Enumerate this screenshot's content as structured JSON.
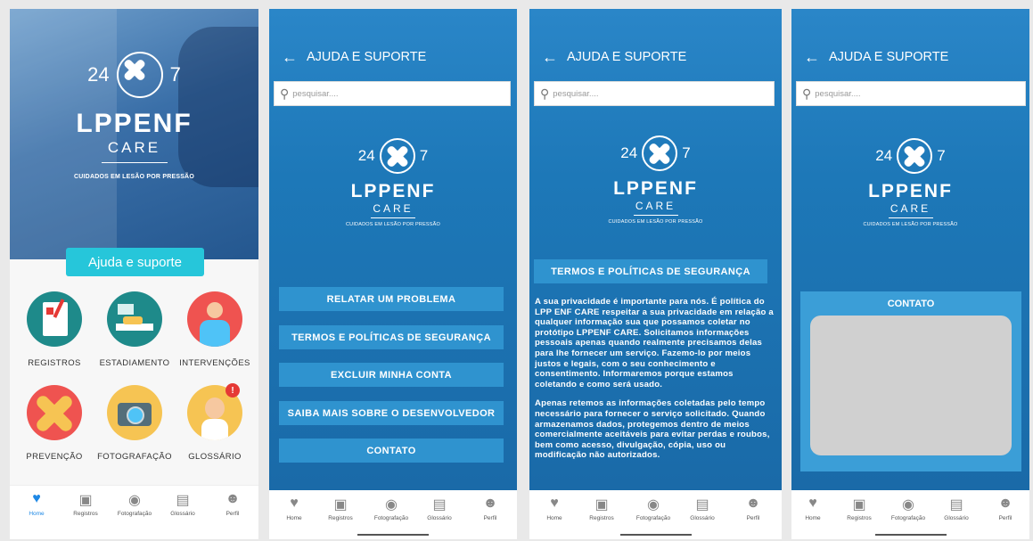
{
  "colors": {
    "accent": "#26c6da",
    "blue": "#1d78b8",
    "badge": "#e53935"
  },
  "logo": {
    "left_num": "24",
    "right_num": "7",
    "name": "LPPENF",
    "care": "CARE",
    "tagline": "CUIDADOS EM LESÃO POR PRESSÃO"
  },
  "screen1": {
    "help_button": "Ajuda e suporte",
    "tiles": [
      {
        "label": "REGISTROS",
        "icon": "clipboard-icon"
      },
      {
        "label": "ESTADIAMENTO",
        "icon": "hospital-bed-icon"
      },
      {
        "label": "INTERVENÇÕES",
        "icon": "injured-patient-icon"
      },
      {
        "label": "PREVENÇÃO",
        "icon": "bandage-icon"
      },
      {
        "label": "FOTOGRAFAÇÃO",
        "icon": "camera-icon"
      },
      {
        "label": "GLOSSÁRIO",
        "icon": "nurse-icon"
      }
    ],
    "badge": "!"
  },
  "header": {
    "back_icon": "arrow-left-icon",
    "title": "AJUDA E SUPORTE"
  },
  "search": {
    "placeholder": "pesquisar...."
  },
  "screen2": {
    "menu": [
      "RELATAR UM PROBLEMA",
      "TERMOS E POLÍTICAS DE SEGURANÇA",
      "EXCLUIR MINHA CONTA",
      "SAIBA MAIS SOBRE O DESENVOLVEDOR",
      "CONTATO"
    ]
  },
  "screen3": {
    "title": "TERMOS E POLÍTICAS DE SEGURANÇA",
    "p1": "A sua privacidade é importante para nós. É política do LPP ENF CARE respeitar a sua privacidade em relação a qualquer informação sua que possamos coletar no protótipo LPPENF CARE. Solicitamos informações pessoais apenas quando realmente precisamos delas para lhe fornecer um serviço. Fazemo-lo por meios justos e legais, com o seu conhecimento e consentimento. Informaremos porque estamos coletando e como será usado.",
    "p2": "Apenas retemos as informações coletadas pelo tempo  necessário para fornecer o serviço solicitado. Quando armazenamos dados, protegemos dentro de meios comercialmente aceitáveis para evitar perdas e roubos, bem como acesso, divulgação, cópia, uso ou modificação não autorizados."
  },
  "screen4": {
    "title": "CONTATO"
  },
  "nav": [
    {
      "label": "Home",
      "icon": "heart-plus-icon"
    },
    {
      "label": "Registros",
      "icon": "medical-kit-icon"
    },
    {
      "label": "Fotografação",
      "icon": "camera-icon"
    },
    {
      "label": "Glossário",
      "icon": "notebook-icon"
    },
    {
      "label": "Perfil",
      "icon": "profile-icon"
    }
  ]
}
